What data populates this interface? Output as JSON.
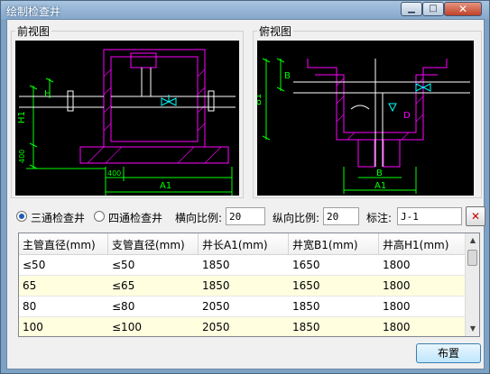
{
  "window": {
    "title": "绘制检查井",
    "close_glyph": "✕",
    "min_glyph": "▁",
    "max_glyph": "□"
  },
  "front_view": {
    "label": "前视图",
    "dims": {
      "h": "H",
      "h1": "H1",
      "d400_v": "400",
      "d400_h": "400",
      "a1": "A1"
    }
  },
  "top_view": {
    "label": "俯视图",
    "dims": {
      "b": "B",
      "b1": "B1",
      "d": "D",
      "bottom_b": "B",
      "bottom_a1": "A1"
    }
  },
  "options": {
    "radio_three": "三通检查井",
    "radio_four": "四通检查井",
    "selected": "three",
    "h_scale_label": "横向比例:",
    "h_scale_value": "20",
    "v_scale_label": "纵向比例:",
    "v_scale_value": "20",
    "note_label": "标注:",
    "note_value": "J-1"
  },
  "table": {
    "columns": [
      "主管直径(mm)",
      "支管直径(mm)",
      "井长A1(mm)",
      "井宽B1(mm)",
      "井高H1(mm)"
    ],
    "rows": [
      [
        "≤50",
        "≤50",
        "1850",
        "1650",
        "1800"
      ],
      [
        "65",
        "≤65",
        "1850",
        "1650",
        "1800"
      ],
      [
        "80",
        "≤80",
        "2050",
        "1850",
        "1800"
      ],
      [
        "100",
        "≤100",
        "2050",
        "1850",
        "1800"
      ]
    ],
    "selected_row": 1
  },
  "buttons": {
    "place": "布置",
    "pick_icon": "pick-point-icon"
  },
  "colors": {
    "drawing_bg": "#000000",
    "pipe": "#ffffff",
    "well": "#ff00ff",
    "dim": "#00ff00",
    "valve": "#00ffff",
    "title_bg": "#86a8cc"
  }
}
